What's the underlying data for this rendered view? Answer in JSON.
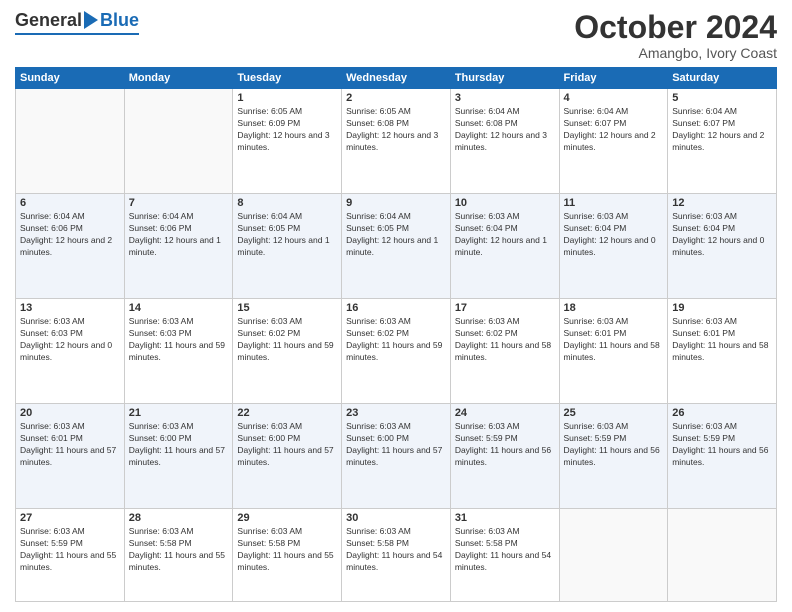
{
  "logo": {
    "general": "General",
    "blue": "Blue"
  },
  "header": {
    "month": "October 2024",
    "location": "Amangbo, Ivory Coast"
  },
  "weekdays": [
    "Sunday",
    "Monday",
    "Tuesday",
    "Wednesday",
    "Thursday",
    "Friday",
    "Saturday"
  ],
  "weeks": [
    [
      {
        "day": "",
        "sunrise": "",
        "sunset": "",
        "daylight": ""
      },
      {
        "day": "",
        "sunrise": "",
        "sunset": "",
        "daylight": ""
      },
      {
        "day": "1",
        "sunrise": "Sunrise: 6:05 AM",
        "sunset": "Sunset: 6:09 PM",
        "daylight": "Daylight: 12 hours and 3 minutes."
      },
      {
        "day": "2",
        "sunrise": "Sunrise: 6:05 AM",
        "sunset": "Sunset: 6:08 PM",
        "daylight": "Daylight: 12 hours and 3 minutes."
      },
      {
        "day": "3",
        "sunrise": "Sunrise: 6:04 AM",
        "sunset": "Sunset: 6:08 PM",
        "daylight": "Daylight: 12 hours and 3 minutes."
      },
      {
        "day": "4",
        "sunrise": "Sunrise: 6:04 AM",
        "sunset": "Sunset: 6:07 PM",
        "daylight": "Daylight: 12 hours and 2 minutes."
      },
      {
        "day": "5",
        "sunrise": "Sunrise: 6:04 AM",
        "sunset": "Sunset: 6:07 PM",
        "daylight": "Daylight: 12 hours and 2 minutes."
      }
    ],
    [
      {
        "day": "6",
        "sunrise": "Sunrise: 6:04 AM",
        "sunset": "Sunset: 6:06 PM",
        "daylight": "Daylight: 12 hours and 2 minutes."
      },
      {
        "day": "7",
        "sunrise": "Sunrise: 6:04 AM",
        "sunset": "Sunset: 6:06 PM",
        "daylight": "Daylight: 12 hours and 1 minute."
      },
      {
        "day": "8",
        "sunrise": "Sunrise: 6:04 AM",
        "sunset": "Sunset: 6:05 PM",
        "daylight": "Daylight: 12 hours and 1 minute."
      },
      {
        "day": "9",
        "sunrise": "Sunrise: 6:04 AM",
        "sunset": "Sunset: 6:05 PM",
        "daylight": "Daylight: 12 hours and 1 minute."
      },
      {
        "day": "10",
        "sunrise": "Sunrise: 6:03 AM",
        "sunset": "Sunset: 6:04 PM",
        "daylight": "Daylight: 12 hours and 1 minute."
      },
      {
        "day": "11",
        "sunrise": "Sunrise: 6:03 AM",
        "sunset": "Sunset: 6:04 PM",
        "daylight": "Daylight: 12 hours and 0 minutes."
      },
      {
        "day": "12",
        "sunrise": "Sunrise: 6:03 AM",
        "sunset": "Sunset: 6:04 PM",
        "daylight": "Daylight: 12 hours and 0 minutes."
      }
    ],
    [
      {
        "day": "13",
        "sunrise": "Sunrise: 6:03 AM",
        "sunset": "Sunset: 6:03 PM",
        "daylight": "Daylight: 12 hours and 0 minutes."
      },
      {
        "day": "14",
        "sunrise": "Sunrise: 6:03 AM",
        "sunset": "Sunset: 6:03 PM",
        "daylight": "Daylight: 11 hours and 59 minutes."
      },
      {
        "day": "15",
        "sunrise": "Sunrise: 6:03 AM",
        "sunset": "Sunset: 6:02 PM",
        "daylight": "Daylight: 11 hours and 59 minutes."
      },
      {
        "day": "16",
        "sunrise": "Sunrise: 6:03 AM",
        "sunset": "Sunset: 6:02 PM",
        "daylight": "Daylight: 11 hours and 59 minutes."
      },
      {
        "day": "17",
        "sunrise": "Sunrise: 6:03 AM",
        "sunset": "Sunset: 6:02 PM",
        "daylight": "Daylight: 11 hours and 58 minutes."
      },
      {
        "day": "18",
        "sunrise": "Sunrise: 6:03 AM",
        "sunset": "Sunset: 6:01 PM",
        "daylight": "Daylight: 11 hours and 58 minutes."
      },
      {
        "day": "19",
        "sunrise": "Sunrise: 6:03 AM",
        "sunset": "Sunset: 6:01 PM",
        "daylight": "Daylight: 11 hours and 58 minutes."
      }
    ],
    [
      {
        "day": "20",
        "sunrise": "Sunrise: 6:03 AM",
        "sunset": "Sunset: 6:01 PM",
        "daylight": "Daylight: 11 hours and 57 minutes."
      },
      {
        "day": "21",
        "sunrise": "Sunrise: 6:03 AM",
        "sunset": "Sunset: 6:00 PM",
        "daylight": "Daylight: 11 hours and 57 minutes."
      },
      {
        "day": "22",
        "sunrise": "Sunrise: 6:03 AM",
        "sunset": "Sunset: 6:00 PM",
        "daylight": "Daylight: 11 hours and 57 minutes."
      },
      {
        "day": "23",
        "sunrise": "Sunrise: 6:03 AM",
        "sunset": "Sunset: 6:00 PM",
        "daylight": "Daylight: 11 hours and 57 minutes."
      },
      {
        "day": "24",
        "sunrise": "Sunrise: 6:03 AM",
        "sunset": "Sunset: 5:59 PM",
        "daylight": "Daylight: 11 hours and 56 minutes."
      },
      {
        "day": "25",
        "sunrise": "Sunrise: 6:03 AM",
        "sunset": "Sunset: 5:59 PM",
        "daylight": "Daylight: 11 hours and 56 minutes."
      },
      {
        "day": "26",
        "sunrise": "Sunrise: 6:03 AM",
        "sunset": "Sunset: 5:59 PM",
        "daylight": "Daylight: 11 hours and 56 minutes."
      }
    ],
    [
      {
        "day": "27",
        "sunrise": "Sunrise: 6:03 AM",
        "sunset": "Sunset: 5:59 PM",
        "daylight": "Daylight: 11 hours and 55 minutes."
      },
      {
        "day": "28",
        "sunrise": "Sunrise: 6:03 AM",
        "sunset": "Sunset: 5:58 PM",
        "daylight": "Daylight: 11 hours and 55 minutes."
      },
      {
        "day": "29",
        "sunrise": "Sunrise: 6:03 AM",
        "sunset": "Sunset: 5:58 PM",
        "daylight": "Daylight: 11 hours and 55 minutes."
      },
      {
        "day": "30",
        "sunrise": "Sunrise: 6:03 AM",
        "sunset": "Sunset: 5:58 PM",
        "daylight": "Daylight: 11 hours and 54 minutes."
      },
      {
        "day": "31",
        "sunrise": "Sunrise: 6:03 AM",
        "sunset": "Sunset: 5:58 PM",
        "daylight": "Daylight: 11 hours and 54 minutes."
      },
      {
        "day": "",
        "sunrise": "",
        "sunset": "",
        "daylight": ""
      },
      {
        "day": "",
        "sunrise": "",
        "sunset": "",
        "daylight": ""
      }
    ]
  ]
}
